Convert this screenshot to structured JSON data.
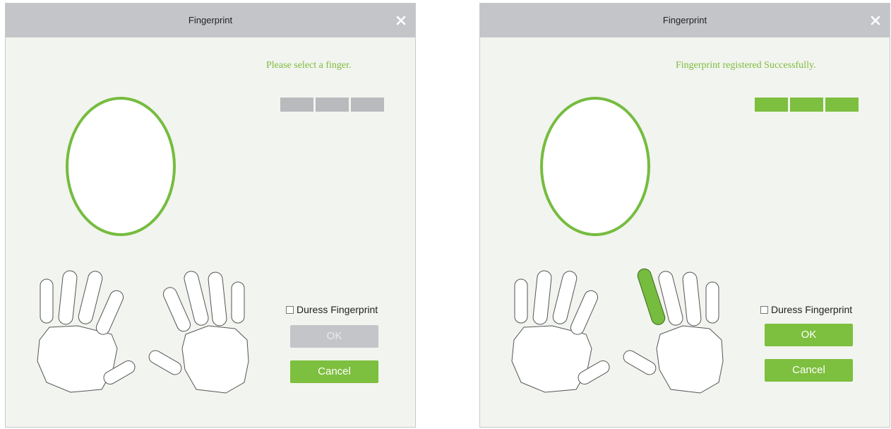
{
  "dialogs": [
    {
      "title": "Fingerprint",
      "status": "Please select a finger.",
      "progress": [
        "gray",
        "gray",
        "gray"
      ],
      "duress_label": "Duress Fingerprint",
      "duress_checked": false,
      "ok_label": "OK",
      "ok_enabled": false,
      "cancel_label": "Cancel",
      "selected_finger": null
    },
    {
      "title": "Fingerprint",
      "status": "Fingerprint registered Successfully.",
      "progress": [
        "green",
        "green",
        "green"
      ],
      "duress_label": "Duress Fingerprint",
      "duress_checked": false,
      "ok_label": "OK",
      "ok_enabled": true,
      "cancel_label": "Cancel",
      "selected_finger": "right-index"
    }
  ],
  "colors": {
    "accent": "#7dbf3e",
    "progress_gray": "#b8babd",
    "progress_green": "#7dbf3e",
    "title_bar": "#c3c5c8",
    "dialog_bg": "#f2f4ef"
  },
  "icons": {
    "close": "close-icon"
  }
}
